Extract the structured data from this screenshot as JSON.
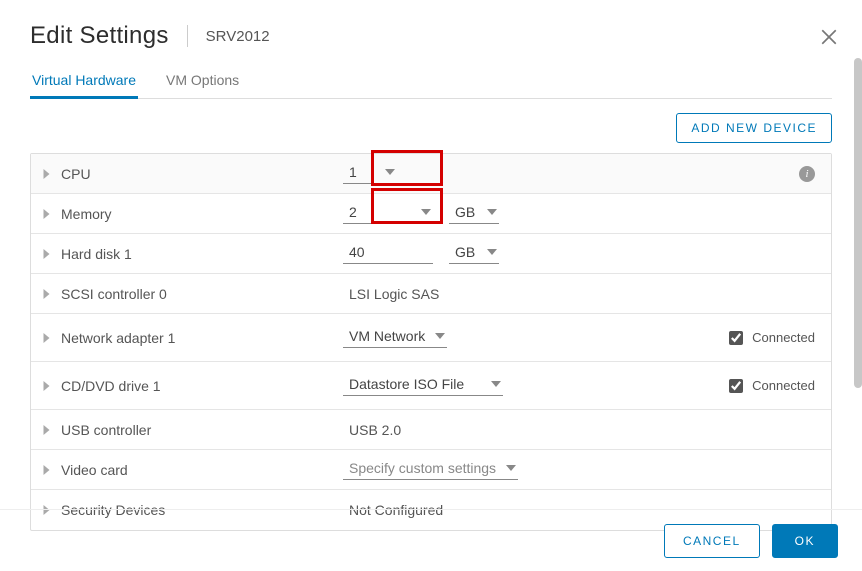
{
  "header": {
    "title": "Edit Settings",
    "vm_name": "SRV2012"
  },
  "tabs": {
    "hardware": "Virtual Hardware",
    "options": "VM Options"
  },
  "buttons": {
    "add_device": "ADD NEW DEVICE",
    "cancel": "CANCEL",
    "ok": "OK"
  },
  "labels": {
    "connected": "Connected"
  },
  "rows": {
    "cpu": {
      "label": "CPU",
      "value": "1"
    },
    "memory": {
      "label": "Memory",
      "value": "2",
      "unit": "GB"
    },
    "disk": {
      "label": "Hard disk 1",
      "value": "40",
      "unit": "GB"
    },
    "scsi": {
      "label": "SCSI controller 0",
      "value": "LSI Logic SAS"
    },
    "net": {
      "label": "Network adapter 1",
      "value": "VM Network",
      "connected": true
    },
    "cd": {
      "label": "CD/DVD drive 1",
      "value": "Datastore ISO File",
      "connected": true
    },
    "usb": {
      "label": "USB controller",
      "value": "USB 2.0"
    },
    "video": {
      "label": "Video card",
      "value": "Specify custom settings"
    },
    "security": {
      "label": "Security Devices",
      "value": "Not Configured"
    }
  }
}
